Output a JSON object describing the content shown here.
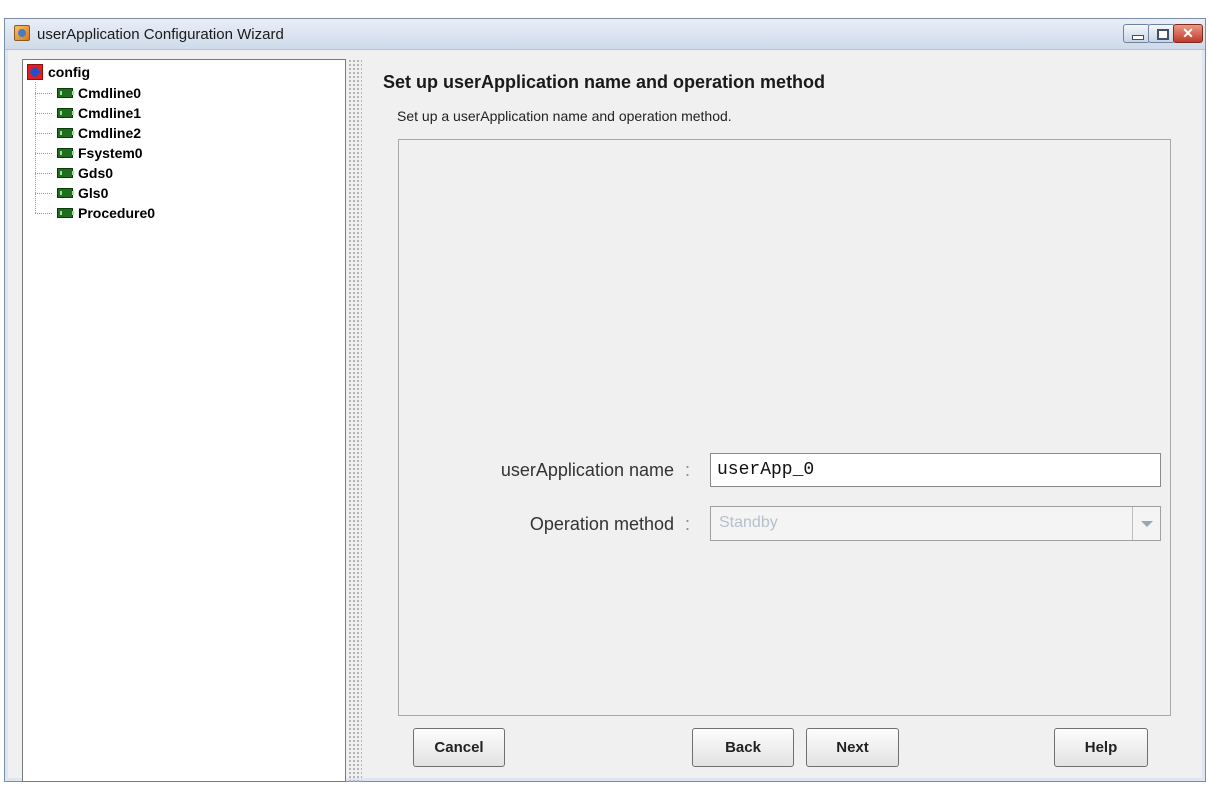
{
  "window": {
    "title": "userApplication Configuration Wizard",
    "close_glyph": "✕"
  },
  "tree": {
    "root_label": "config",
    "items": [
      {
        "label": "Cmdline0"
      },
      {
        "label": "Cmdline1"
      },
      {
        "label": "Cmdline2"
      },
      {
        "label": "Fsystem0"
      },
      {
        "label": "Gds0"
      },
      {
        "label": "Gls0"
      },
      {
        "label": "Procedure0"
      }
    ]
  },
  "main": {
    "heading": "Set up userApplication name and operation method",
    "subheading": "Set up a userApplication name and operation method.",
    "name_label": "userApplication name",
    "name_value": "userApp_0",
    "method_label": "Operation method",
    "method_value": "Standby",
    "separator": ":"
  },
  "buttons": {
    "cancel": "Cancel",
    "back": "Back",
    "next": "Next",
    "help": "Help"
  },
  "colors": {
    "disabled_text": "#b6bfcc",
    "close_button": "#c0392b"
  }
}
